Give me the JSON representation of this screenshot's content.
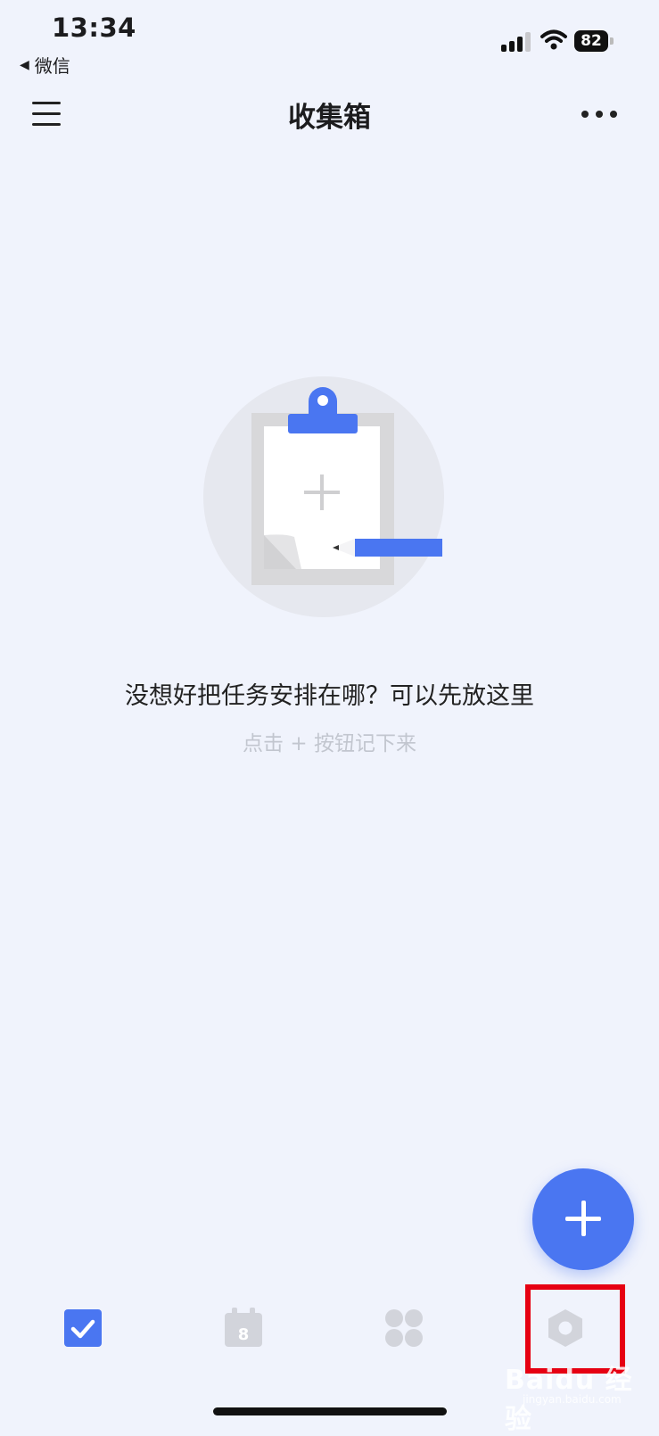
{
  "status_bar": {
    "time": "13:34",
    "back_app": "微信",
    "battery": "82"
  },
  "header": {
    "title": "收集箱"
  },
  "empty_state": {
    "title": "没想好把任务安排在哪？可以先放这里",
    "hint": "点击 + 按钮记下来"
  },
  "tab_bar": {
    "calendar_day": "8",
    "selected": "tasks"
  },
  "watermark": {
    "brand": "Baidu 经验",
    "url": "jingyan.baidu.com"
  },
  "colors": {
    "accent": "#4a76f1",
    "background": "#f0f3fc",
    "highlight_box": "#e60012"
  }
}
